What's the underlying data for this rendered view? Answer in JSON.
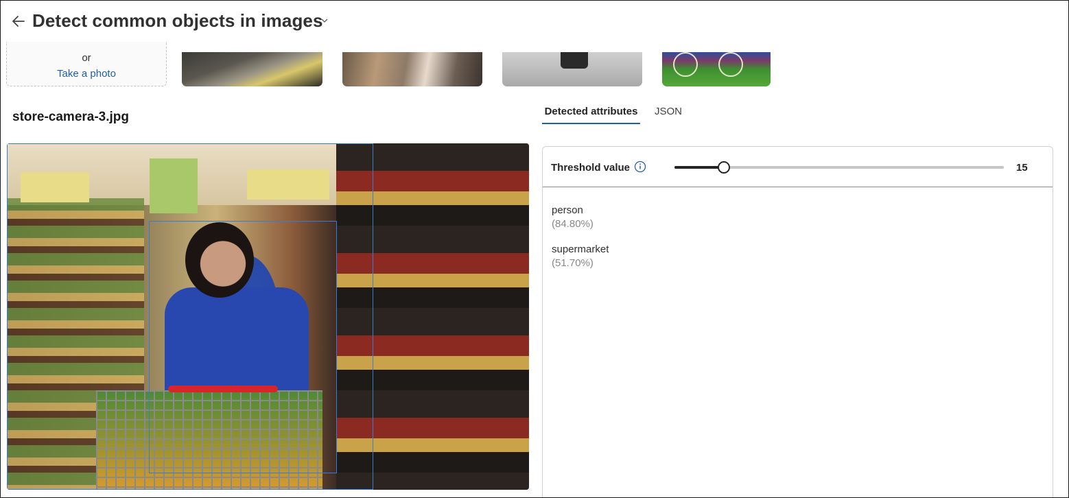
{
  "header": {
    "title": "Detect common objects in images"
  },
  "upload": {
    "or_text": "or",
    "take_photo_label": "Take a photo"
  },
  "file": {
    "name": "store-camera-3.jpg"
  },
  "tabs": [
    {
      "label": "Detected attributes",
      "active": true
    },
    {
      "label": "JSON",
      "active": false
    }
  ],
  "threshold": {
    "label": "Threshold value",
    "value": "15",
    "fraction": 0.15
  },
  "results": [
    {
      "name": "person",
      "confidence": "(84.80%)"
    },
    {
      "name": "supermarket",
      "confidence": "(51.70%)"
    }
  ],
  "colors": {
    "accent": "#1f5fa8",
    "bbox": "#3a7bd5"
  }
}
